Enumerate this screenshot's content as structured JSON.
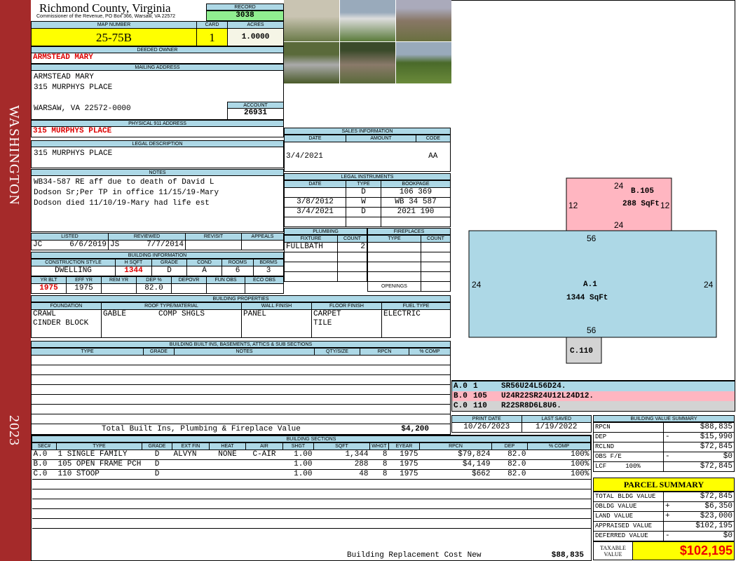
{
  "band": {
    "district": "WASHINGTON",
    "year": "2023"
  },
  "header": {
    "county": "Richmond County, Virginia",
    "subtitle": "Commissioner of the Revenue, PO Box 366, Warsaw, VA 22572",
    "record_label": "RECORD",
    "record": "3038",
    "map_label": "MAP NUMBER",
    "map_number": "25-75B",
    "card_label": "CARD",
    "card": "1",
    "acres_label": "ACRES",
    "acres": "1.0000"
  },
  "owner": {
    "label": "DEEDED OWNER",
    "name": "ARMSTEAD MARY"
  },
  "mailing": {
    "label": "MAILING ADDRESS",
    "line1": "ARMSTEAD MARY",
    "line2": "315 MURPHYS PLACE",
    "line3": "WARSAW, VA 22572-0000",
    "account_label": "ACCOUNT",
    "account": "26931"
  },
  "physical": {
    "label": "PHYSICAL 911 ADDRESS",
    "value": "315 MURPHYS PLACE"
  },
  "legal": {
    "label": "LEGAL DESCRIPTION",
    "value": "315 MURPHYS PLACE"
  },
  "notes": {
    "label": "NOTES",
    "value": "WB34-587 RE aff due to death of David L\nDodson Sr;Per TP in office 11/15/19-Mary\nDodson died 11/10/19-Mary had life est"
  },
  "review": {
    "headers": [
      "LISTED",
      "REVIEWED",
      "REVISIT",
      "APPEALS"
    ],
    "listed_by": "JC",
    "listed": "6/6/2019",
    "reviewed_by": "JS",
    "reviewed": "7/7/2014"
  },
  "building_info": {
    "label": "BUILDING INFORMATION",
    "h1": [
      "CONSTRUCTION STYLE",
      "H SQFT",
      "GRADE",
      "COND",
      "ROOMS",
      "BDRMS"
    ],
    "v1": [
      "DWELLING",
      "1344",
      "D",
      "A",
      "6",
      "3"
    ],
    "h2": [
      "YR BLT",
      "EFF YR",
      "REM YR",
      "DEP %",
      "DEPOVR",
      "FUN OBS",
      "ECO OBS"
    ],
    "v2": [
      "1975",
      "1975",
      "",
      "82.0",
      "",
      "",
      ""
    ]
  },
  "sales": {
    "label": "SALES INFORMATION",
    "headers": [
      "DATE",
      "AMOUNT",
      "CODE"
    ],
    "rows": [
      [
        "",
        "",
        ""
      ],
      [
        "3/4/2021",
        "",
        "AA"
      ],
      [
        "",
        "",
        ""
      ]
    ]
  },
  "instruments": {
    "label": "LEGAL INSTRUMENTS",
    "headers": [
      "DATE",
      "TYPE",
      "BOOKPAGE"
    ],
    "rows": [
      [
        "",
        "D",
        "106 369"
      ],
      [
        "3/8/2012",
        "W",
        "WB 34 587"
      ],
      [
        "3/4/2021",
        "D",
        "2021 190"
      ],
      [
        "",
        "",
        ""
      ]
    ]
  },
  "plumbing": {
    "label": "PLUMBING",
    "headers": [
      "FIXTURE",
      "COUNT"
    ],
    "rows": [
      [
        "FULLBATH",
        "2"
      ]
    ]
  },
  "fireplaces": {
    "label": "FIREPLACES",
    "headers": [
      "TYPE",
      "COUNT"
    ],
    "openings": "OPENINGS"
  },
  "properties": {
    "label": "BUILDING PROPERTIES",
    "headers": [
      "FOUNDATION",
      "ROOF TYPE/MATERIAL",
      "WALL FINISH",
      "FLOOR FINISH",
      "FUEL TYPE"
    ],
    "foundation": "CRAWL\nCINDER BLOCK",
    "roof_type": "GABLE",
    "roof_material": "COMP SHGLS",
    "wall": "PANEL",
    "floor": "CARPET\nTILE",
    "fuel": "ELECTRIC"
  },
  "builtins": {
    "label": "BUILDING BUILT INS, BASEMENTS, ATTICS & SUB SECTIONS",
    "headers": [
      "TYPE",
      "GRADE",
      "NOTES",
      "QTY/SIZE",
      "RPCN",
      "% COMP"
    ],
    "total_label": "Total Built Ins, Plumbing & Fireplace Value",
    "total": "$4,200"
  },
  "sections": {
    "label": "BUILDING SECTIONS",
    "headers": [
      "SEC#",
      "TYPE",
      "GRADE",
      "EXT FIN",
      "HEAT",
      "AIR",
      "SHGT",
      "SQFT",
      "WHGT",
      "EYEAR",
      "RPCN",
      "DEP",
      "% COMP"
    ],
    "rows": [
      [
        "A.0",
        "1 SINGLE FAMILY",
        "D",
        "ALVYN",
        "NONE",
        "C-AIR",
        "1.00",
        "1,344",
        "8",
        "1975",
        "$79,824",
        "82.0",
        "100%"
      ],
      [
        "B.0",
        "105 OPEN FRAME PCH",
        "D",
        "",
        "",
        "",
        "1.00",
        "288",
        "8",
        "1975",
        "$4,149",
        "82.0",
        "100%"
      ],
      [
        "C.0",
        "110 STOOP",
        "D",
        "",
        "",
        "",
        "1.00",
        "48",
        "8",
        "1975",
        "$662",
        "82.0",
        "100%"
      ]
    ],
    "rcn_label": "Building Replacement Cost New",
    "rcn": "$88,835"
  },
  "dates": {
    "print_label": "PRINT DATE",
    "print": "10/26/2023",
    "saved_label": "LAST SAVED",
    "saved": "1/19/2022"
  },
  "sketch": {
    "areas": [
      {
        "code": "B.105",
        "sqft": "288 SqFt",
        "sides": [
          "24",
          "12",
          "24",
          "12"
        ]
      },
      {
        "code": "A.1",
        "sqft": "1344 SqFt",
        "sides": [
          "56",
          "24",
          "56",
          "24"
        ]
      },
      {
        "code": "C.110"
      }
    ],
    "codes": [
      [
        "A.0",
        "1",
        "SR56U24L56D24."
      ],
      [
        "B.0",
        "105",
        "U24R22SR24U12L24D12."
      ],
      [
        "C.0",
        "110",
        "R22SR8D6L8U6."
      ]
    ],
    "colors": {
      "A": "#add8e6",
      "B": "#ffb6c1",
      "C": "#d3d3d3"
    }
  },
  "value_summary": {
    "label": "BUILDING VALUE SUMMARY",
    "rows": [
      [
        "RPCN",
        "",
        "$88,835"
      ],
      [
        "DEP",
        "-",
        "$15,990"
      ],
      [
        "RCLND",
        "",
        "$72,845"
      ],
      [
        "OBS F/E",
        "-",
        "$0"
      ],
      [
        "LCF     100%",
        "",
        "$72,845"
      ]
    ]
  },
  "parcel": {
    "label": "PARCEL SUMMARY",
    "rows": [
      [
        "TOTAL BLDG VALUE",
        "",
        "$72,845"
      ],
      [
        "OBLDG VALUE",
        "+",
        "$6,350"
      ],
      [
        "LAND VALUE",
        "+",
        "$23,000"
      ],
      [
        "APPRAISED VALUE",
        "",
        "$102,195"
      ],
      [
        "DEFERRED VALUE",
        "-",
        "$0"
      ]
    ],
    "taxable_label": "TAXABLE VALUE",
    "taxable": "$102,195"
  }
}
